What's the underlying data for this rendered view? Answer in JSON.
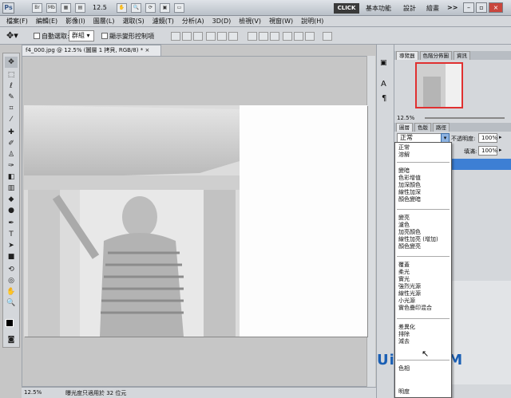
{
  "titlebar": {
    "logo": "Ps",
    "icons": [
      "Br",
      "Mb"
    ],
    "zoom": "12.5",
    "click_label": "CLICK",
    "workspace_basic": "基本功能",
    "workspace_design": "設計",
    "workspace_paint": "繪畫",
    "more": ">>"
  },
  "menus": [
    "檔案(F)",
    "編輯(E)",
    "影像(I)",
    "圖層(L)",
    "選取(S)",
    "濾鏡(T)",
    "分析(A)",
    "3D(D)",
    "檢視(V)",
    "視窗(W)",
    "說明(H)"
  ],
  "options": {
    "auto_select_label": "自動選取:",
    "auto_select_value": "群組",
    "show_transform_label": "顯示變形控制項"
  },
  "document": {
    "tab_title": "f4_000.jpg @ 12.5% (圖層 1 拷貝, RGB/8) *",
    "close": "×"
  },
  "status": {
    "zoom": "12.5%",
    "info": "曝光度只適用於 32 位元"
  },
  "navigator": {
    "tabs": [
      "導覽器",
      "色階分佈圖",
      "資訊"
    ],
    "zoom": "12.5%"
  },
  "layers": {
    "tabs": [
      "圖層",
      "色版",
      "路徑"
    ],
    "mode_value": "正常",
    "opacity_label": "不透明度:",
    "opacity_value": "100%",
    "fill_label": "填滿:",
    "fill_value": "100%"
  },
  "blend_modes": {
    "groups": [
      [
        "正常",
        "溶解"
      ],
      [
        "變暗",
        "色彩增值",
        "加深顏色",
        "線性加深",
        "顏色變暗"
      ],
      [
        "變亮",
        "濾色",
        "加亮顏色",
        "線性加亮 (增加)",
        "顏色變亮"
      ],
      [
        "覆蓋",
        "柔光",
        "實光",
        "強烈光源",
        "線性光源",
        "小光源",
        "實色疊印混合"
      ],
      [
        "差異化",
        "排除",
        "減去",
        "分割"
      ],
      [
        "色相",
        "明度"
      ]
    ],
    "selected": "分割"
  },
  "watermark": "UiBQ.CoM"
}
